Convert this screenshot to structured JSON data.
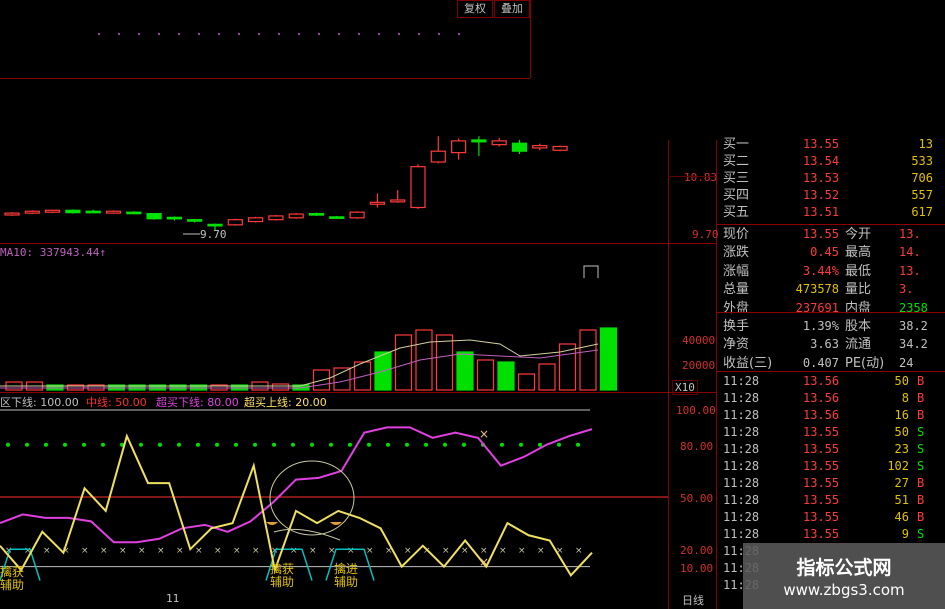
{
  "toolbar": {
    "restore_label": "复权",
    "overlay_label": "叠加"
  },
  "price_axis": {
    "high_label": "10.83",
    "low_label": "9.70",
    "low_marker": "9.70"
  },
  "volume": {
    "ma_label": "MA10: 337943.44↑",
    "axis": [
      "40000",
      "20000"
    ],
    "unit": "X10"
  },
  "indicator": {
    "legend": [
      {
        "text": "区下线: 100.00",
        "color": "#c0c0c0"
      },
      {
        "text": "中线: 50.00",
        "color": "#ff3030"
      },
      {
        "text": "超买下线: 80.00",
        "color": "#e040e0"
      },
      {
        "text": "超买上线: 20.00",
        "color": "#ffe060"
      }
    ],
    "axis": [
      "100.00",
      "80.00",
      "50.00",
      "20.00",
      "10.00"
    ],
    "caption_1": "擒获\n辅助",
    "caption_2": "擒获\n辅助",
    "caption_3": "擒进\n辅助",
    "period": "日线",
    "date_tick": "11"
  },
  "order_book": [
    {
      "label": "买一",
      "price": "13.55",
      "vol": "13"
    },
    {
      "label": "买二",
      "price": "13.54",
      "vol": "533"
    },
    {
      "label": "买三",
      "price": "13.53",
      "vol": "706"
    },
    {
      "label": "买四",
      "price": "13.52",
      "vol": "557"
    },
    {
      "label": "买五",
      "price": "13.51",
      "vol": "617"
    }
  ],
  "stats": [
    {
      "l1": "现价",
      "v1": "13.55",
      "c1": "#ff3a3a",
      "l2": "今开",
      "v2": "13.",
      "c2": "#ff3a3a"
    },
    {
      "l1": "涨跌",
      "v1": "0.45",
      "c1": "#ff3a3a",
      "l2": "最高",
      "v2": "14.",
      "c2": "#ff3a3a"
    },
    {
      "l1": "涨幅",
      "v1": "3.44%",
      "c1": "#ff3a3a",
      "l2": "最低",
      "v2": "13.",
      "c2": "#ff3a3a"
    },
    {
      "l1": "总量",
      "v1": "473578",
      "c1": "#e0c000",
      "l2": "量比",
      "v2": "3.",
      "c2": "#ff3a3a"
    },
    {
      "l1": "外盘",
      "v1": "237691",
      "c1": "#ff3a3a",
      "l2": "内盘",
      "v2": "2358",
      "c2": "#00e000"
    },
    {
      "l1": "换手",
      "v1": "1.39%",
      "c1": "#c0c0c0",
      "l2": "股本",
      "v2": "38.2",
      "c2": "#c0c0c0"
    },
    {
      "l1": "净资",
      "v1": "3.63",
      "c1": "#c0c0c0",
      "l2": "流通",
      "v2": "34.2",
      "c2": "#c0c0c0"
    },
    {
      "l1": "收益(三)",
      "v1": "0.407",
      "c1": "#c0c0c0",
      "l2": "PE(动)",
      "v2": "24",
      "c2": "#c0c0c0"
    }
  ],
  "ticks": [
    {
      "time": "11:28",
      "price": "13.56",
      "vol": "50",
      "side": "B",
      "color": "#ff3a3a"
    },
    {
      "time": "11:28",
      "price": "13.56",
      "vol": "8",
      "side": "B",
      "color": "#ff3a3a"
    },
    {
      "time": "11:28",
      "price": "13.56",
      "vol": "16",
      "side": "B",
      "color": "#ff3a3a"
    },
    {
      "time": "11:28",
      "price": "13.55",
      "vol": "50",
      "side": "S",
      "color": "#00e000"
    },
    {
      "time": "11:28",
      "price": "13.55",
      "vol": "23",
      "side": "S",
      "color": "#00e000"
    },
    {
      "time": "11:28",
      "price": "13.55",
      "vol": "102",
      "side": "S",
      "color": "#00e000"
    },
    {
      "time": "11:28",
      "price": "13.55",
      "vol": "27",
      "side": "B",
      "color": "#ff3a3a"
    },
    {
      "time": "11:28",
      "price": "13.55",
      "vol": "51",
      "side": "B",
      "color": "#ff3a3a"
    },
    {
      "time": "11:28",
      "price": "13.55",
      "vol": "46",
      "side": "B",
      "color": "#ff3a3a"
    },
    {
      "time": "11:28",
      "price": "13.55",
      "vol": "9",
      "side": "S",
      "color": "#00e000"
    },
    {
      "time": "11:28",
      "price": "",
      "vol": "",
      "side": "",
      "color": "#c0c0c0"
    },
    {
      "time": "11:28",
      "price": "",
      "vol": "",
      "side": "",
      "color": "#c0c0c0"
    },
    {
      "time": "11:28",
      "price": "",
      "vol": "",
      "side": "",
      "color": "#c0c0c0"
    }
  ],
  "watermark": {
    "title": "指标公式网",
    "url": "www.zbgs3.com"
  },
  "candles": [
    {
      "o": 10.02,
      "c": 10.06,
      "h": 10.08,
      "l": 10.0
    },
    {
      "o": 10.06,
      "c": 10.1,
      "h": 10.12,
      "l": 10.04
    },
    {
      "o": 10.08,
      "c": 10.12,
      "h": 10.13,
      "l": 10.06
    },
    {
      "o": 10.12,
      "c": 10.07,
      "h": 10.14,
      "l": 10.05
    },
    {
      "o": 10.1,
      "c": 10.08,
      "h": 10.13,
      "l": 10.06
    },
    {
      "o": 10.06,
      "c": 10.1,
      "h": 10.12,
      "l": 10.05
    },
    {
      "o": 10.08,
      "c": 10.06,
      "h": 10.1,
      "l": 10.04
    },
    {
      "o": 10.05,
      "c": 9.94,
      "h": 10.06,
      "l": 9.92
    },
    {
      "o": 9.97,
      "c": 9.94,
      "h": 9.99,
      "l": 9.9
    },
    {
      "o": 9.92,
      "c": 9.89,
      "h": 9.93,
      "l": 9.86
    },
    {
      "o": 9.82,
      "c": 9.79,
      "h": 9.84,
      "l": 9.7
    },
    {
      "o": 9.81,
      "c": 9.92,
      "h": 9.94,
      "l": 9.79
    },
    {
      "o": 9.88,
      "c": 9.96,
      "h": 9.98,
      "l": 9.86
    },
    {
      "o": 9.92,
      "c": 10.0,
      "h": 10.02,
      "l": 9.9
    },
    {
      "o": 9.96,
      "c": 10.04,
      "h": 10.06,
      "l": 9.94
    },
    {
      "o": 10.05,
      "c": 10.02,
      "h": 10.07,
      "l": 10.0
    },
    {
      "o": 9.98,
      "c": 9.96,
      "h": 10.0,
      "l": 9.94
    },
    {
      "o": 9.96,
      "c": 10.08,
      "h": 10.1,
      "l": 9.94
    },
    {
      "o": 10.25,
      "c": 10.29,
      "h": 10.48,
      "l": 10.18
    },
    {
      "o": 10.3,
      "c": 10.34,
      "h": 10.55,
      "l": 10.28
    },
    {
      "o": 10.18,
      "c": 11.05,
      "h": 11.1,
      "l": 10.15
    },
    {
      "o": 11.15,
      "c": 11.38,
      "h": 11.7,
      "l": 11.12
    },
    {
      "o": 11.35,
      "c": 11.6,
      "h": 11.65,
      "l": 11.2
    },
    {
      "o": 11.62,
      "c": 11.58,
      "h": 11.7,
      "l": 11.28
    },
    {
      "o": 11.52,
      "c": 11.6,
      "h": 11.66,
      "l": 11.48
    },
    {
      "o": 11.55,
      "c": 11.38,
      "h": 11.62,
      "l": 11.32
    },
    {
      "o": 11.45,
      "c": 11.5,
      "h": 11.54,
      "l": 11.4
    },
    {
      "o": 11.4,
      "c": 11.48,
      "h": 11.5,
      "l": 11.38
    }
  ],
  "volumes": [
    {
      "v": 8,
      "up": true
    },
    {
      "v": 8,
      "up": true
    },
    {
      "v": 5,
      "up": false
    },
    {
      "v": 5,
      "up": true
    },
    {
      "v": 5,
      "up": true
    },
    {
      "v": 5,
      "up": false
    },
    {
      "v": 5,
      "up": false
    },
    {
      "v": 5,
      "up": false
    },
    {
      "v": 5,
      "up": false
    },
    {
      "v": 5,
      "up": false
    },
    {
      "v": 5,
      "up": true
    },
    {
      "v": 5,
      "up": false
    },
    {
      "v": 8,
      "up": true
    },
    {
      "v": 6,
      "up": true
    },
    {
      "v": 5,
      "up": false
    },
    {
      "v": 20,
      "up": true
    },
    {
      "v": 22,
      "up": true
    },
    {
      "v": 28,
      "up": true
    },
    {
      "v": 38,
      "up": false
    },
    {
      "v": 55,
      "up": true
    },
    {
      "v": 60,
      "up": true
    },
    {
      "v": 55,
      "up": true
    },
    {
      "v": 38,
      "up": false
    },
    {
      "v": 30,
      "up": true
    },
    {
      "v": 28,
      "up": false
    },
    {
      "v": 16,
      "up": true
    },
    {
      "v": 26,
      "up": true
    },
    {
      "v": 46,
      "up": true
    },
    {
      "v": 60,
      "up": true
    },
    {
      "v": 62,
      "up": false
    }
  ],
  "kdj": {
    "yellow": [
      22,
      8,
      30,
      18,
      55,
      42,
      85,
      58,
      58,
      20,
      32,
      35,
      68,
      8,
      42,
      35,
      42,
      38,
      32,
      10,
      22,
      10,
      25,
      10,
      35,
      28,
      25,
      5,
      18
    ],
    "magenta": [
      35,
      40,
      38,
      38,
      36,
      24,
      24,
      26,
      32,
      34,
      30,
      36,
      47,
      60,
      61,
      65,
      87,
      90,
      90,
      84,
      87,
      84,
      68,
      73,
      80,
      85,
      89
    ],
    "dots_level": 80,
    "cross_level": 20
  }
}
